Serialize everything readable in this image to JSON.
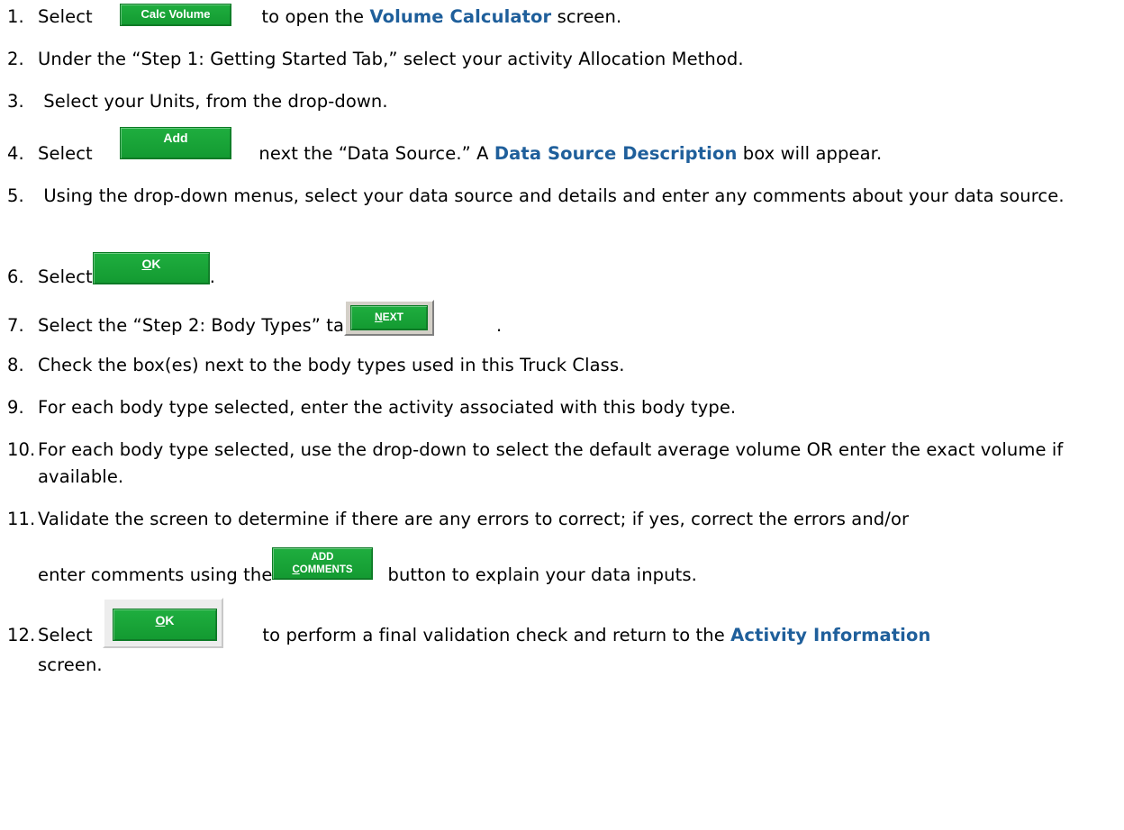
{
  "steps": [
    {
      "num": "1.",
      "before": "Select",
      "after": "to open the",
      "link": "Volume Calculator",
      "end": "screen."
    },
    {
      "num": "2.",
      "text": "Under the “Step 1: Getting Started Tab,” select your activity Allocation Method."
    },
    {
      "num": "3.",
      "text": " Select your Units, from the drop-down."
    },
    {
      "num": "4.",
      "before": "Select",
      "after": "next the “Data Source.” A",
      "link": "Data Source Description",
      "end": "box will appear."
    },
    {
      "num": "5.",
      "text": " Using the drop-down menus, select your data source and details and enter any comments about your data source."
    },
    {
      "num": "6.",
      "before": "Select",
      "end": "."
    },
    {
      "num": "7.",
      "before": "Select the “Step 2: Body Types” tab or",
      "end": "."
    },
    {
      "num": "8.",
      "text": "Check the box(es) next to the body types used in this Truck Class."
    },
    {
      "num": "9.",
      "text": "For each body type selected, enter the activity associated with this body type."
    },
    {
      "num": "10.",
      "text": "For each body type selected, use the drop-down to select the default average volume OR enter the exact volume if available."
    },
    {
      "num": "11.",
      "text": "Validate the screen to determine if there are any errors to correct; if yes, correct the errors and/or",
      "line2_before": "enter comments using the",
      "line2_after": "button to explain your data inputs."
    },
    {
      "num": "12.",
      "before": "Select",
      "after": "to perform a final validation check and return to the",
      "link": "Activity Information",
      "line2": "screen."
    }
  ],
  "buttons": {
    "calc_volume": "Calc Volume",
    "add": "Add",
    "ok_mnemonic": "O",
    "ok_rest": "K",
    "next_mnemonic": "N",
    "next_rest": "EXT",
    "add_comments_top": "ADD",
    "add_comments_mnemonic": "C",
    "add_comments_rest": "OMMENTS"
  },
  "colors": {
    "link": "#1f5f9b",
    "button_green": "#16a236"
  }
}
